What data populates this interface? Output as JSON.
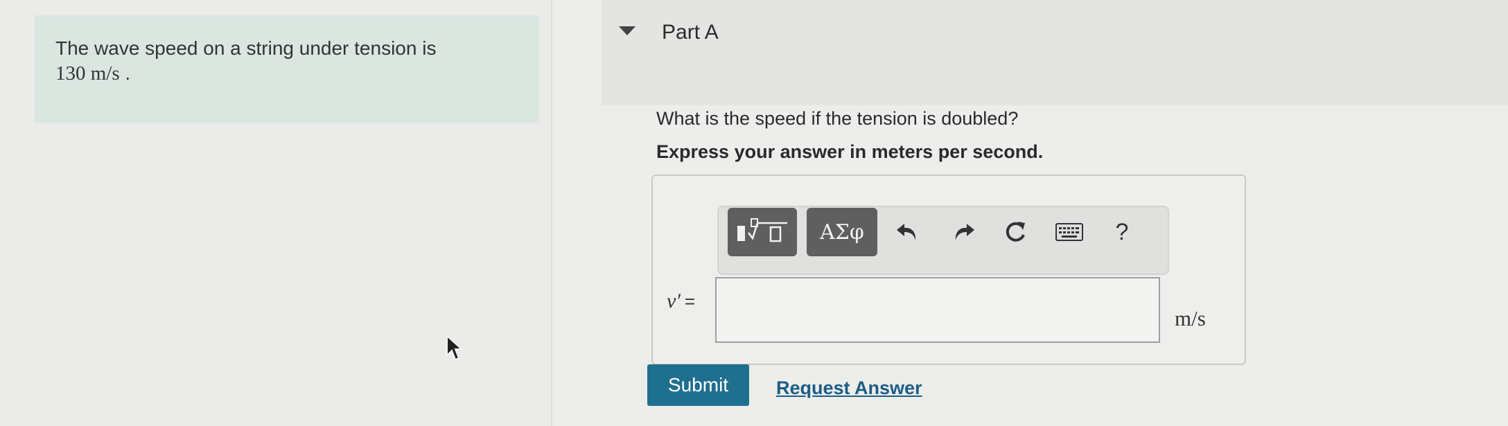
{
  "intro": {
    "text": "The wave speed on a string under tension is",
    "value": "130  m/s",
    "period": " ."
  },
  "part": {
    "title": "Part A",
    "question": "What is the speed if the tension is doubled?",
    "instruction": "Express your answer in meters per second."
  },
  "toolbar": {
    "symbols_label": "ΑΣφ",
    "help_label": "?",
    "icons": [
      "templates-icon",
      "undo-icon",
      "redo-icon",
      "reset-icon",
      "keyboard-icon"
    ]
  },
  "answer": {
    "variable": "v′",
    "equals": "=",
    "value": "",
    "unit": "m/s"
  },
  "actions": {
    "submit_label": "Submit",
    "request_label": "Request Answer"
  },
  "colors": {
    "intro_background": "#dbe6e1",
    "submit_background": "#1f6f8f",
    "link": "#1d5d87",
    "toolbar_button": "#5f5f5f"
  }
}
